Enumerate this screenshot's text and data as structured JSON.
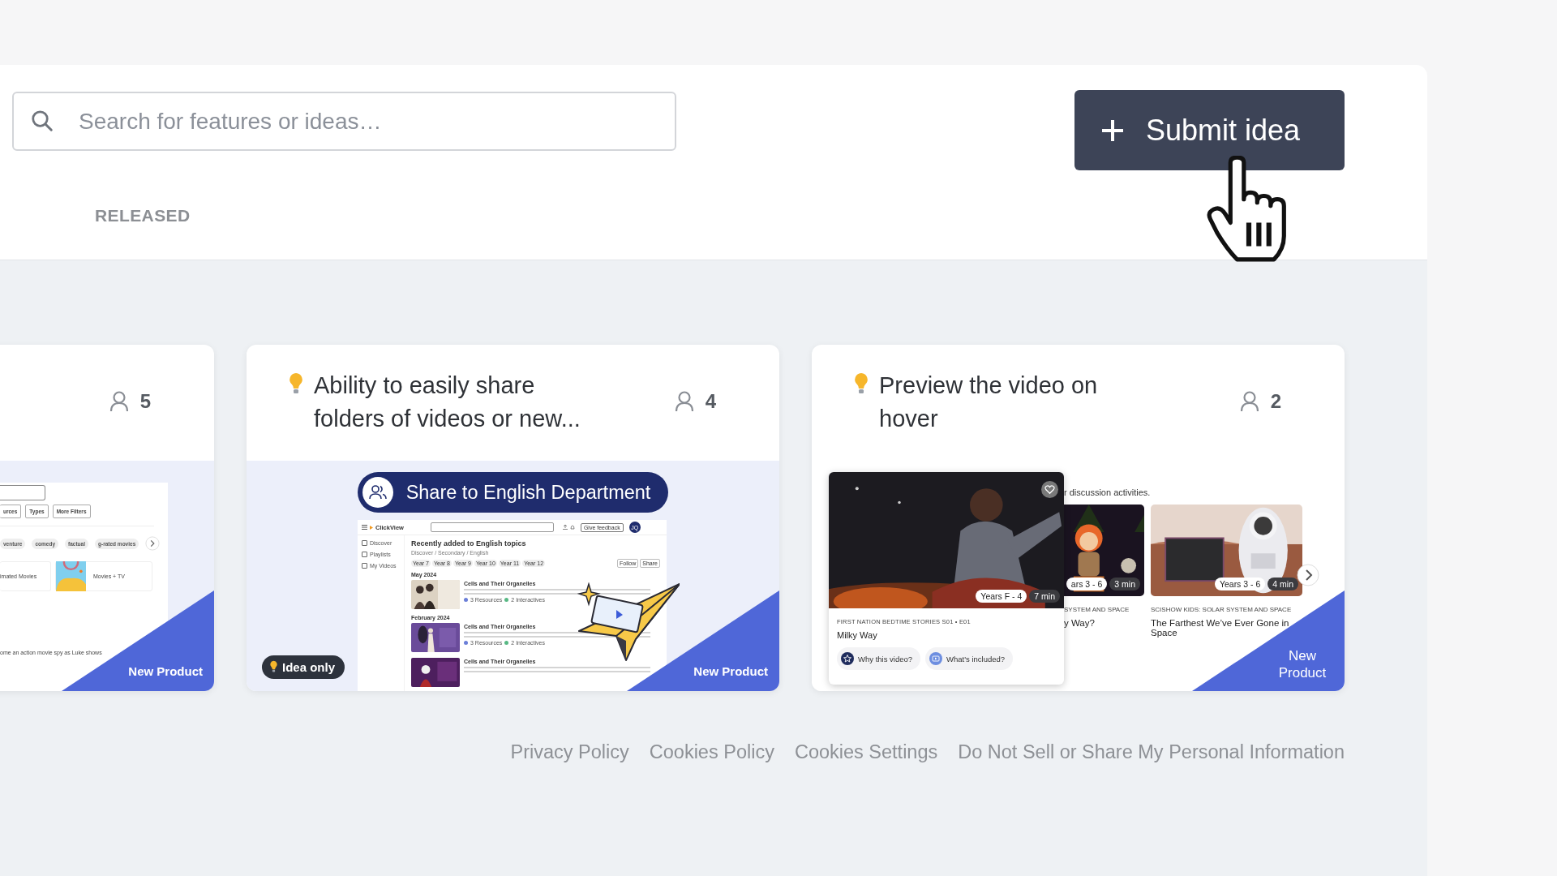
{
  "search": {
    "placeholder": "Search for features or ideas…"
  },
  "submit_button": {
    "label": "Submit idea"
  },
  "tabs": [
    {
      "label": "RELEASED",
      "selected": false
    }
  ],
  "cards": [
    {
      "votes": "5",
      "tag": "New Product",
      "preview": {
        "kind": "filters",
        "filter_buttons": [
          "urces",
          "Types",
          "More Filters"
        ],
        "tags": [
          "venture",
          "comedy",
          "factual",
          "g-rated movies"
        ],
        "tiles": [
          "imated Movies",
          "Movies + TV"
        ],
        "caption": "ome an action movie spy as Luke shows"
      }
    },
    {
      "title": "Ability to easily share folders of videos or new...",
      "votes": "4",
      "tag": "New Product",
      "badge": "Idea only",
      "preview": {
        "kind": "share",
        "share_label": "Share to English Department",
        "app": {
          "logo": "ClickView",
          "feedback": "Give feedback",
          "avatar": "JQ",
          "nav": [
            "Discover",
            "Playlists",
            "My Videos"
          ],
          "heading": "Recently added to English topics",
          "breadcrumb": "Discover / Secondary / English",
          "years": [
            "Year 7",
            "Year 8",
            "Year 9",
            "Year 10",
            "Year 11",
            "Year 12"
          ],
          "actions": [
            "Follow",
            "Share"
          ],
          "sections": [
            {
              "date": "May 2024",
              "items": [
                {
                  "title": "Cells and Their Organelles",
                  "meta": [
                    "3 Resources",
                    "2 Interactives"
                  ]
                }
              ]
            },
            {
              "date": "February 2024",
              "items": [
                {
                  "title": "Cells and Their Organelles",
                  "meta": [
                    "3 Resources",
                    "2 Interactives"
                  ]
                },
                {
                  "title": "Cells and Their Organelles"
                }
              ]
            }
          ]
        }
      }
    },
    {
      "title": "Preview the video on hover",
      "votes": "2",
      "tag": "New Product",
      "preview": {
        "kind": "hover",
        "caption": "r discussion activities.",
        "popup": {
          "years": "Years F - 4",
          "duration": "7 min",
          "series": "FIRST NATION BEDTIME STORIES S01 • E01",
          "title": "Milky Way",
          "actions": [
            "Why this video?",
            "What's included?"
          ]
        },
        "videos": [
          {
            "years": "ars 3 - 6",
            "duration": "3 min",
            "series": "SYSTEM AND SPACE",
            "title": "y Way?"
          },
          {
            "years": "Years 3 - 6",
            "duration": "4 min",
            "series": "SCISHOW KIDS: SOLAR SYSTEM AND SPACE",
            "title": "The Farthest We’ve Ever Gone in Space"
          }
        ]
      }
    }
  ],
  "footer_links": [
    "Privacy Policy",
    "Cookies Policy",
    "Cookies Settings",
    "Do Not Sell or Share My Personal Information"
  ]
}
